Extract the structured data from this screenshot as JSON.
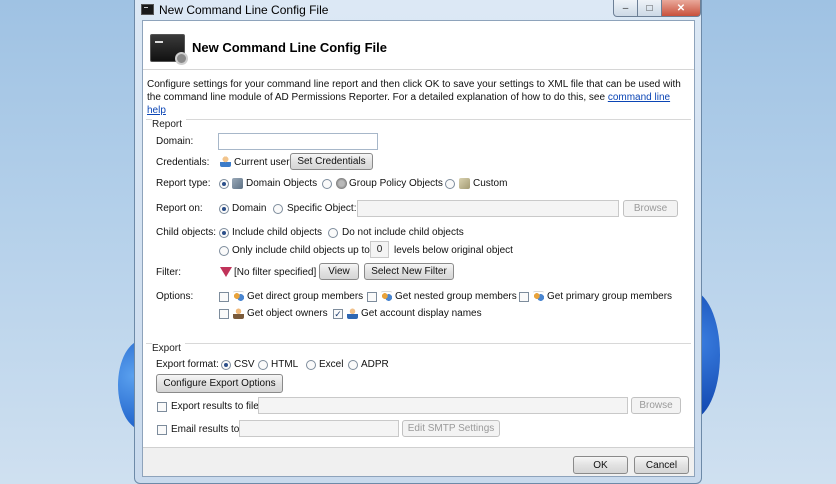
{
  "window": {
    "title": "New Command Line Config File",
    "minimize_glyph": "–",
    "maximize_glyph": "□",
    "close_glyph": "✕"
  },
  "header": {
    "title": "New Command Line Config File",
    "icon": "command-prompt-gear-icon"
  },
  "description": {
    "text": "Configure settings for your command line report and then click OK to save your settings to XML file that can be used with the command line module of AD Permissions Reporter. For a detailed explanation of how to do this, see ",
    "link": "command line help"
  },
  "report": {
    "group_label": "Report",
    "domain": {
      "label": "Domain:",
      "value": ""
    },
    "credentials": {
      "label": "Credentials:",
      "value": "Current user",
      "button": "Set Credentials"
    },
    "report_type": {
      "label": "Report type:",
      "options": [
        "Domain Objects",
        "Group Policy Objects",
        "Custom"
      ],
      "selected": "Domain Objects"
    },
    "report_on": {
      "label": "Report on:",
      "options": [
        "Domain",
        "Specific Object:"
      ],
      "selected": "Domain",
      "object_value": "",
      "browse": "Browse"
    },
    "child_objects": {
      "label": "Child objects:",
      "options": [
        "Include child objects",
        "Do not include child objects",
        "Only include child objects up to"
      ],
      "selected": "Include child objects",
      "levels_value": "0",
      "levels_suffix": "levels below original object"
    },
    "filter": {
      "label": "Filter:",
      "value": "[No filter specified]",
      "view_button": "View",
      "select_button": "Select New Filter"
    },
    "options": {
      "label": "Options:",
      "items": [
        {
          "label": "Get direct group members",
          "checked": false
        },
        {
          "label": "Get nested group members",
          "checked": false
        },
        {
          "label": "Get primary group members",
          "checked": false
        },
        {
          "label": "Get object owners",
          "checked": false
        },
        {
          "label": "Get account display names",
          "checked": true
        }
      ]
    }
  },
  "export": {
    "group_label": "Export",
    "format": {
      "label": "Export format:",
      "options": [
        "CSV",
        "HTML",
        "Excel",
        "ADPR"
      ],
      "selected": "CSV"
    },
    "configure_button": "Configure Export Options",
    "to_file": {
      "label": "Export results to file:",
      "checked": false,
      "value": "",
      "browse": "Browse"
    },
    "email": {
      "label": "Email results to:",
      "checked": false,
      "value": "",
      "smtp_button": "Edit SMTP Settings"
    }
  },
  "footer": {
    "ok": "OK",
    "cancel": "Cancel"
  },
  "colors": {
    "link": "#0b45b5",
    "frame": "#c9daed",
    "accent_radio": "#2c4f8a"
  }
}
